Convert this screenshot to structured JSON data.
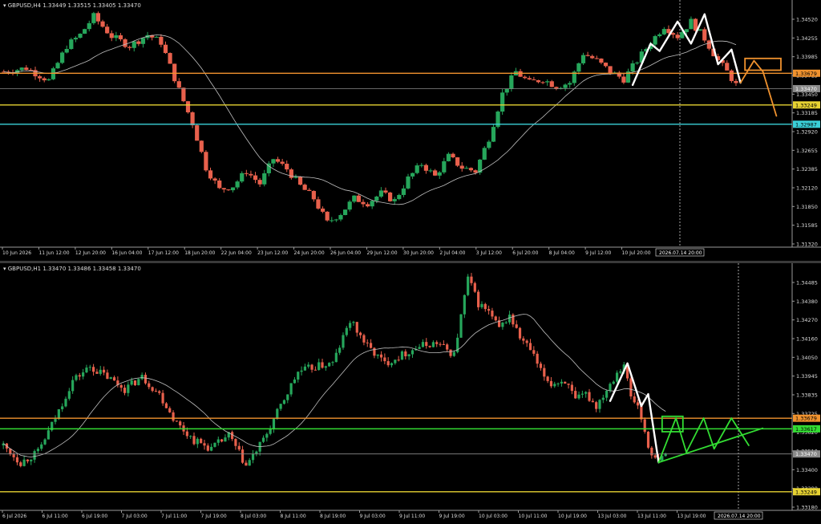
{
  "colors": {
    "background": "#000000",
    "bull": "#26a65b",
    "bear": "#e8604c",
    "ma": "#bfbfbf",
    "orange": "#f0922e",
    "yellow": "#e6d232",
    "cyan": "#3ad0d8",
    "green": "#33dd33",
    "white": "#ffffff",
    "grey_level": "#8a8a8a",
    "text": "#dddddd"
  },
  "charts": [
    {
      "title": "GBPUSD,H4  1.33449 1.33515 1.33405 1.33470",
      "ylim": [
        1.3132,
        1.3452
      ],
      "price_labels": [
        "1.34520",
        "1.34255",
        "1.33985",
        "1.33715",
        "1.33450",
        "1.33185",
        "1.32920",
        "1.32655",
        "1.32385",
        "1.32120",
        "1.31850",
        "1.31585",
        "1.31320"
      ],
      "level_labels": [
        {
          "text": "1.33679",
          "value": 1.33679,
          "color": "orange"
        },
        {
          "text": "1.33470",
          "value": 1.3347,
          "color": "grey_level"
        },
        {
          "text": "1.33249",
          "value": 1.33249,
          "color": "yellow"
        },
        {
          "text": "1.32987",
          "value": 1.32987,
          "color": "cyan"
        }
      ],
      "time_labels": [
        "10 Jun 2026",
        "11 Jun 12:00",
        "12 Jun 20:00",
        "16 Jun 04:00",
        "17 Jun 12:00",
        "18 Jun 20:00",
        "22 Jun 04:00",
        "23 Jun 12:00",
        "24 Jun 20:00",
        "26 Jun 04:00",
        "29 Jun 12:00",
        "30 Jun 20:00",
        "2 Jul 04:00",
        "3 Jul 12:00",
        "6 Jul 20:00",
        "8 Jul 04:00",
        "9 Jul 12:00",
        "10 Jul 20:00"
      ],
      "crosshair_label": "2026.07.14 20:00",
      "path_anchors": [
        [
          0,
          1.337
        ],
        [
          5,
          1.3375
        ],
        [
          10,
          1.3358
        ],
        [
          14,
          1.3405
        ],
        [
          17,
          1.342
        ],
        [
          20,
          1.3445
        ],
        [
          24,
          1.3418
        ],
        [
          28,
          1.3405
        ],
        [
          32,
          1.342
        ],
        [
          35,
          1.341
        ],
        [
          39,
          1.3345
        ],
        [
          42,
          1.33
        ],
        [
          45,
          1.324
        ],
        [
          48,
          1.321
        ],
        [
          51,
          1.3215
        ],
        [
          54,
          1.3235
        ],
        [
          57,
          1.3218
        ],
        [
          60,
          1.3252
        ],
        [
          63,
          1.3238
        ],
        [
          66,
          1.3215
        ],
        [
          69,
          1.3198
        ],
        [
          72,
          1.3165
        ],
        [
          75,
          1.3178
        ],
        [
          78,
          1.3198
        ],
        [
          81,
          1.3192
        ],
        [
          84,
          1.3205
        ],
        [
          87,
          1.3195
        ],
        [
          90,
          1.3225
        ],
        [
          93,
          1.3245
        ],
        [
          96,
          1.3228
        ],
        [
          99,
          1.3255
        ],
        [
          102,
          1.324
        ],
        [
          105,
          1.3235
        ],
        [
          108,
          1.328
        ],
        [
          111,
          1.334
        ],
        [
          114,
          1.337
        ],
        [
          117,
          1.3355
        ],
        [
          120,
          1.336
        ],
        [
          123,
          1.335
        ],
        [
          126,
          1.3355
        ],
        [
          129,
          1.3395
        ],
        [
          132,
          1.3385
        ],
        [
          135,
          1.337
        ],
        [
          138,
          1.336
        ],
        [
          141,
          1.3385
        ],
        [
          144,
          1.341
        ],
        [
          147,
          1.3432
        ],
        [
          150,
          1.3418
        ],
        [
          153,
          1.3438
        ],
        [
          156,
          1.3415
        ],
        [
          159,
          1.3385
        ],
        [
          161,
          1.337
        ],
        [
          163,
          1.3352
        ]
      ],
      "overlays": {
        "hlines": [
          {
            "value": 1.33679,
            "color": "orange",
            "width": 1.4
          },
          {
            "value": 1.3347,
            "color": "grey_level",
            "width": 0.8
          },
          {
            "value": 1.33249,
            "color": "yellow",
            "width": 1.4
          },
          {
            "value": 1.32987,
            "color": "cyan",
            "width": 1.4
          }
        ],
        "white_path": [
          [
            140,
            1.3352
          ],
          [
            144,
            1.3408
          ],
          [
            146,
            1.3398
          ],
          [
            150,
            1.3438
          ],
          [
            153,
            1.3408
          ],
          [
            156,
            1.3448
          ],
          [
            159,
            1.338
          ],
          [
            162,
            1.34
          ],
          [
            164,
            1.3355
          ]
        ],
        "orange_path": [
          [
            164,
            1.3355
          ],
          [
            167,
            1.3385
          ],
          [
            169,
            1.337
          ],
          [
            172,
            1.331
          ]
        ],
        "orange_box": [
          [
            165,
            1.3388
          ],
          [
            173,
            1.3372
          ]
        ]
      }
    },
    {
      "title": "GBPUSD,H1  1.33470 1.33486 1.33458 1.33470",
      "ylim": [
        1.3314,
        1.3452
      ],
      "price_labels": [
        "1.34485",
        "1.34380",
        "1.34270",
        "1.34160",
        "1.34050",
        "1.33945",
        "1.33835",
        "1.33725",
        "1.33620",
        "1.33510",
        "1.33400",
        "1.33290",
        "1.33180"
      ],
      "level_labels": [
        {
          "text": "1.33679",
          "value": 1.33679,
          "color": "orange"
        },
        {
          "text": "1.33617",
          "value": 1.33617,
          "color": "green"
        },
        {
          "text": "1.33470",
          "value": 1.3347,
          "color": "grey_level"
        },
        {
          "text": "1.33249",
          "value": 1.33249,
          "color": "yellow"
        }
      ],
      "time_labels": [
        "6 Jul 2026",
        "6 Jul 11:00",
        "6 Jul 19:00",
        "7 Jul 03:00",
        "7 Jul 11:00",
        "7 Jul 19:00",
        "8 Jul 03:00",
        "8 Jul 11:00",
        "8 Jul 19:00",
        "9 Jul 03:00",
        "9 Jul 11:00",
        "9 Jul 19:00",
        "10 Jul 03:00",
        "10 Jul 11:00",
        "10 Jul 19:00",
        "13 Jul 03:00",
        "13 Jul 11:00",
        "13 Jul 19:00"
      ],
      "crosshair_label": "2026.07.14 20:00",
      "path_anchors": [
        [
          0,
          1.3352
        ],
        [
          5,
          1.3342
        ],
        [
          10,
          1.3348
        ],
        [
          15,
          1.3368
        ],
        [
          20,
          1.339
        ],
        [
          25,
          1.3398
        ],
        [
          30,
          1.3392
        ],
        [
          35,
          1.3385
        ],
        [
          40,
          1.3392
        ],
        [
          45,
          1.3382
        ],
        [
          50,
          1.3365
        ],
        [
          55,
          1.3355
        ],
        [
          60,
          1.335
        ],
        [
          65,
          1.3358
        ],
        [
          70,
          1.334
        ],
        [
          75,
          1.3355
        ],
        [
          80,
          1.3375
        ],
        [
          85,
          1.3395
        ],
        [
          90,
          1.3398
        ],
        [
          95,
          1.34
        ],
        [
          100,
          1.3425
        ],
        [
          105,
          1.341
        ],
        [
          110,
          1.34
        ],
        [
          115,
          1.3405
        ],
        [
          120,
          1.341
        ],
        [
          125,
          1.3412
        ],
        [
          130,
          1.3405
        ],
        [
          134,
          1.345
        ],
        [
          137,
          1.3435
        ],
        [
          140,
          1.343
        ],
        [
          143,
          1.342
        ],
        [
          146,
          1.3428
        ],
        [
          149,
          1.3415
        ],
        [
          152,
          1.3408
        ],
        [
          155,
          1.3395
        ],
        [
          158,
          1.3388
        ],
        [
          162,
          1.339
        ],
        [
          165,
          1.3378
        ],
        [
          168,
          1.3382
        ],
        [
          171,
          1.3375
        ],
        [
          174,
          1.3385
        ],
        [
          177,
          1.3395
        ],
        [
          179,
          1.34
        ],
        [
          181,
          1.338
        ],
        [
          183,
          1.3375
        ],
        [
          185,
          1.336
        ],
        [
          187,
          1.3345
        ],
        [
          189,
          1.3342
        ],
        [
          191,
          1.3347
        ]
      ],
      "overlays": {
        "hlines": [
          {
            "value": 1.33679,
            "color": "orange",
            "width": 1.4
          },
          {
            "value": 1.33617,
            "color": "green",
            "width": 1.4
          },
          {
            "value": 1.3347,
            "color": "grey_level",
            "width": 0.8
          },
          {
            "value": 1.33249,
            "color": "yellow",
            "width": 1.4
          }
        ],
        "white_path": [
          [
            175,
            1.3378
          ],
          [
            180,
            1.34
          ],
          [
            184,
            1.3375
          ],
          [
            186,
            1.3382
          ],
          [
            189,
            1.3342
          ]
        ],
        "green_path": [
          [
            189,
            1.3342
          ],
          [
            194,
            1.3368
          ],
          [
            197,
            1.3348
          ],
          [
            202,
            1.3368
          ],
          [
            205,
            1.335
          ],
          [
            210,
            1.3368
          ],
          [
            215,
            1.3352
          ]
        ],
        "green_line": [
          [
            189,
            1.3342
          ],
          [
            219,
            1.3362
          ]
        ],
        "green_box": [
          [
            190,
            1.3369
          ],
          [
            196,
            1.336
          ]
        ]
      }
    }
  ]
}
